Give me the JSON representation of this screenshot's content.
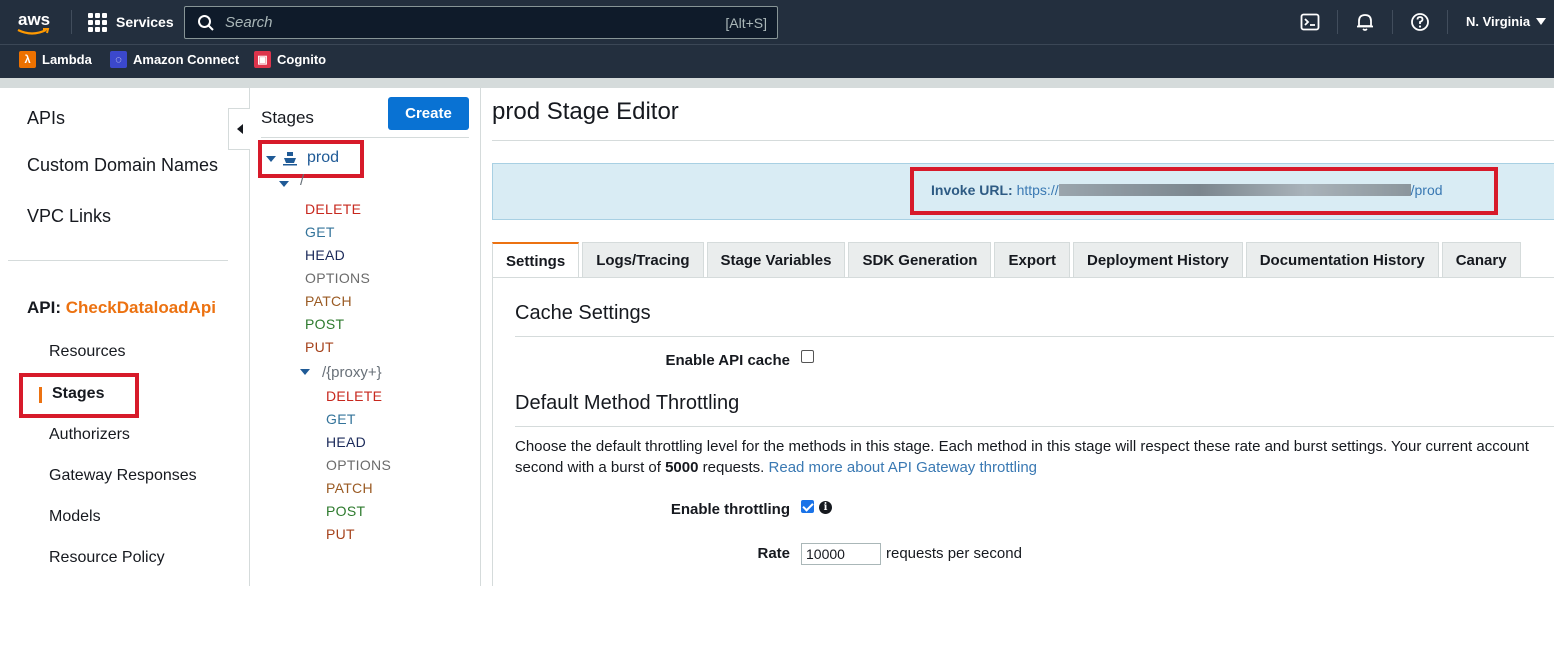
{
  "topbar": {
    "logo": "aws",
    "services_label": "Services",
    "search_placeholder": "Search",
    "search_shortcut": "[Alt+S]",
    "region": "N. Virginia"
  },
  "favorites": [
    {
      "label": "Lambda",
      "icon": "lambda-icon",
      "color": "#ed7100"
    },
    {
      "label": "Amazon Connect",
      "icon": "amazon-connect-icon",
      "color": "#3b48cc"
    },
    {
      "label": "Cognito",
      "icon": "cognito-icon",
      "color": "#dd344c"
    }
  ],
  "nav": {
    "items": [
      "APIs",
      "Custom Domain Names",
      "VPC Links"
    ],
    "api_key": "API:",
    "api_name": "CheckDataloadApi",
    "sub_items": [
      "Resources",
      "Stages",
      "Authorizers",
      "Gateway Responses",
      "Models",
      "Resource Policy"
    ]
  },
  "stages_panel": {
    "title": "Stages",
    "create_label": "Create",
    "stage_name": "prod",
    "root_path": "/",
    "root_methods": [
      "DELETE",
      "GET",
      "HEAD",
      "OPTIONS",
      "PATCH",
      "POST",
      "PUT"
    ],
    "proxy_path": "/{proxy+}",
    "proxy_methods": [
      "DELETE",
      "GET",
      "HEAD",
      "OPTIONS",
      "PATCH",
      "POST",
      "PUT"
    ]
  },
  "main": {
    "title": "prod Stage Editor",
    "invoke_label": "Invoke URL:",
    "invoke_prefix": "https://",
    "invoke_suffix": "/prod",
    "tabs": [
      "Settings",
      "Logs/Tracing",
      "Stage Variables",
      "SDK Generation",
      "Export",
      "Deployment History",
      "Documentation History",
      "Canary"
    ],
    "active_tab": "Settings",
    "cache_section": "Cache Settings",
    "enable_cache_label": "Enable API cache",
    "enable_cache_checked": false,
    "throttle_section": "Default Method Throttling",
    "throttle_para_1": "Choose the default throttling level for the methods in this stage. Each method in this stage will respect these rate and burst settings. Your current account",
    "throttle_para_2a": "second with a burst of",
    "throttle_para_burst": "5000",
    "throttle_para_2b": "requests.",
    "throttle_link": "Read more about API Gateway throttling",
    "enable_throttling_label": "Enable throttling",
    "enable_throttling_checked": true,
    "rate_label": "Rate",
    "rate_value": "10000",
    "rate_unit": "requests per second"
  },
  "colors": {
    "header_bg": "#232f3e",
    "primary_button": "#0972d3",
    "accent_orange": "#ec7211",
    "highlight_red": "#d71a2a"
  }
}
